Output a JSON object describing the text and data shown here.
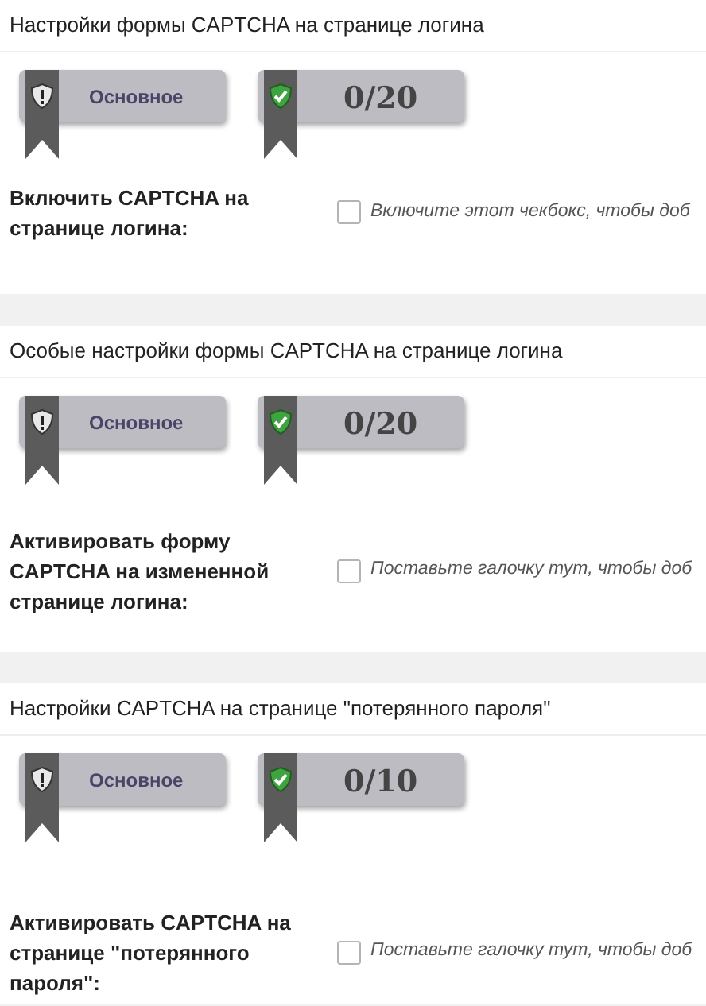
{
  "sections": [
    {
      "title": "Настройки формы CAPTCHA на странице логина",
      "badges": [
        {
          "kind": "level",
          "text": "Основное"
        },
        {
          "kind": "count",
          "text": "0/20"
        }
      ],
      "option": {
        "label": "Включить CAPTCHA на странице логина:",
        "checked": false,
        "hint": "Включите этот чекбокс, чтобы доб"
      }
    },
    {
      "title": "Особые настройки формы CAPTCHA на странице логина",
      "badges": [
        {
          "kind": "level",
          "text": "Основное"
        },
        {
          "kind": "count",
          "text": "0/20"
        }
      ],
      "option": {
        "label": "Активировать форму CAPTCHA на измененной странице логина:",
        "checked": false,
        "hint": "Поставьте галочку тут, чтобы доб"
      }
    },
    {
      "title": "Настройки CAPTCHA на странице \"потерянного пароля\"",
      "badges": [
        {
          "kind": "level",
          "text": "Основное"
        },
        {
          "kind": "count",
          "text": "0/10"
        }
      ],
      "option": {
        "label": "Активировать CAPTCHA на странице \"потерянного пароля\":",
        "checked": false,
        "hint": "Поставьте галочку тут, чтобы доб"
      }
    }
  ]
}
